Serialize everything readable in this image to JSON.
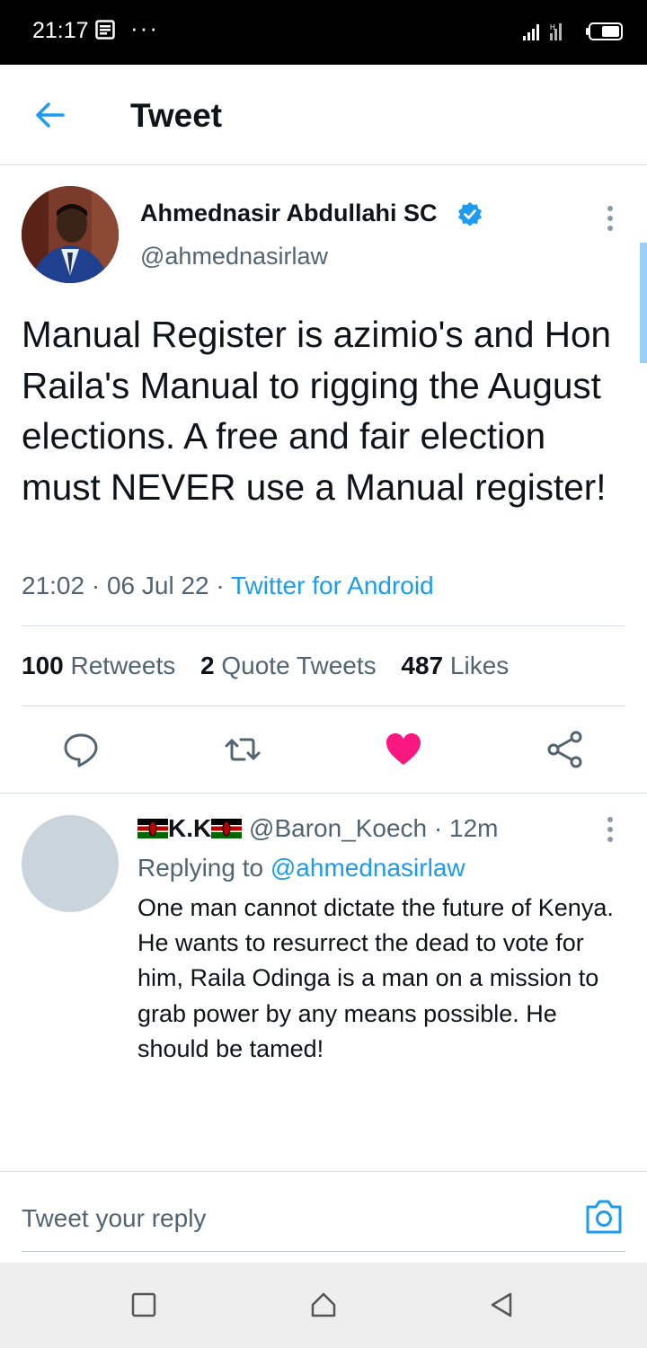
{
  "status_bar": {
    "time": "21:17",
    "dots": "···",
    "icons": [
      "news-icon",
      "signal-icon",
      "wifi-icon",
      "battery-icon"
    ]
  },
  "header": {
    "title": "Tweet",
    "back_icon": "arrow-left-icon"
  },
  "tweet": {
    "author_name": "Ahmednasir Abdullahi SC",
    "verified": true,
    "author_handle": "@ahmednasirlaw",
    "text": "Manual Register is azimio's and Hon Raila's Manual to rigging the August elections. A free and fair election must NEVER use a Manual register!",
    "time": "21:02",
    "date": "06 Jul 22",
    "separator": "·",
    "source": "Twitter for Android",
    "stats": {
      "retweets_count": "100",
      "retweets_label": "Retweets",
      "quotes_count": "2",
      "quotes_label": "Quote Tweets",
      "likes_count": "487",
      "likes_label": "Likes"
    },
    "actions": [
      "reply-icon",
      "retweet-icon",
      "like-icon",
      "share-icon"
    ],
    "liked": true
  },
  "reply": {
    "name": "K.K",
    "handle": "@Baron_Koech",
    "separator": "·",
    "age": "12m",
    "replying_label": "Replying to",
    "replying_to": "@ahmednasirlaw",
    "text": "One man cannot dictate the future of Kenya. He wants to resurrect the dead to vote for him, Raila Odinga is a man on a mission to grab power by any means possible. He should be tamed!"
  },
  "compose": {
    "placeholder": "Tweet your reply"
  },
  "colors": {
    "accent": "#1d9bf0",
    "like": "#f91880",
    "text": "#0f1419",
    "muted": "#536471"
  }
}
